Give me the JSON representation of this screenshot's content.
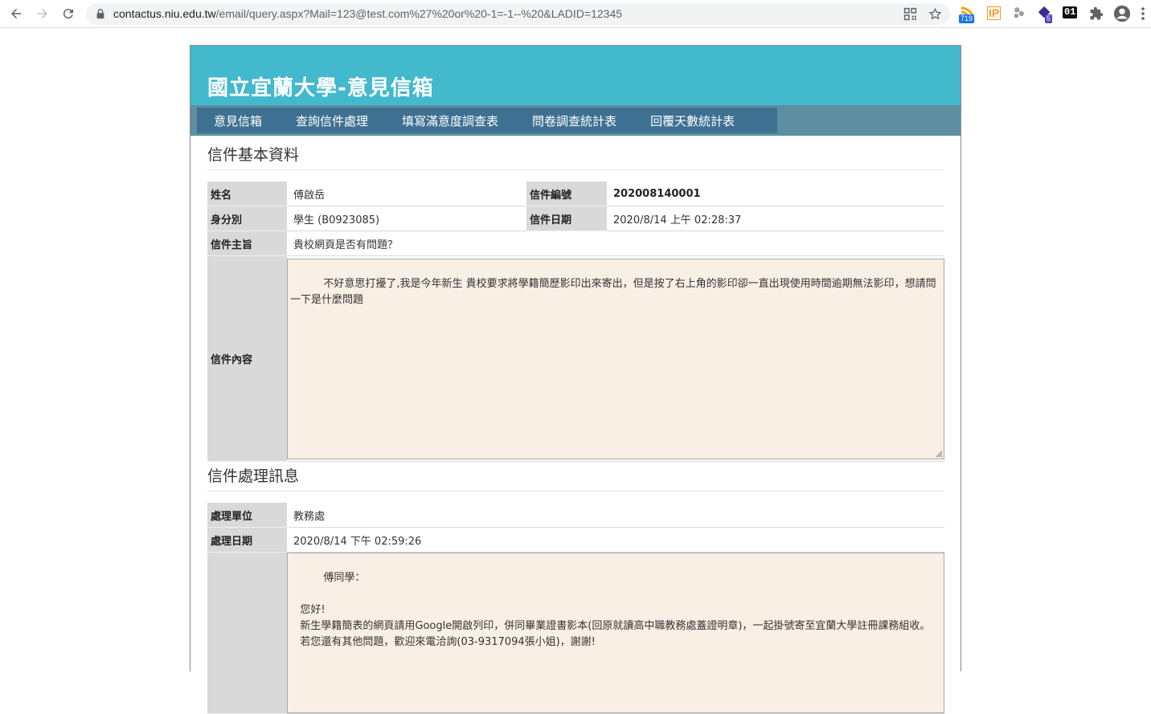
{
  "browser": {
    "url_host": "contactus.niu.edu.tw",
    "url_path": "/email/query.aspx?Mail=123@test.com%27%20or%20-1=-1--%20&LADID=12345",
    "ext_badge_rss": "719",
    "ext_badge_5": "5",
    "ext_label_ip": "IP",
    "ext_label_01": "01"
  },
  "site": {
    "title": "國立宜蘭大學-意見信箱"
  },
  "nav": {
    "items": [
      "意見信箱",
      "查詢信件處理",
      "填寫滿意度調查表",
      "問卷調查統計表",
      "回覆天數統計表"
    ]
  },
  "mail_info": {
    "section_title": "信件基本資料",
    "name_label": "姓名",
    "name_value": "傅啟岳",
    "number_label": "信件編號",
    "number_value": "202008140001",
    "identity_label": "身分別",
    "identity_value": "學生 (B0923085)",
    "date_label": "信件日期",
    "date_value": "2020/8/14 上午 02:28:37",
    "subject_label": "信件主旨",
    "subject_value": "貴校網頁是否有問題？",
    "content_label": "信件內容",
    "content_value": "不好意思打擾了,我是今年新生 貴校要求將學籍簡歷影印出來寄出，但是按了右上角的影印卻一直出現使用時間逾期無法影印，想請問一下是什麼問題"
  },
  "processing": {
    "section_title": "信件處理訊息",
    "unit_label": "處理單位",
    "unit_value": "教務處",
    "date_label": "處理日期",
    "date_value": "2020/8/14 下午 02:59:26",
    "reply_value": "傅同學：\n\n   您好!\n   新生學籍簡表的網頁請用Google開啟列印，併同畢業證書影本(回原就讀高中職教務處蓋證明章)，一起掛號寄至宜蘭大學註冊課務組收。\n   若您還有其他問題，歡迎來電洽詢(03-9317094張小姐)，謝謝!"
  }
}
